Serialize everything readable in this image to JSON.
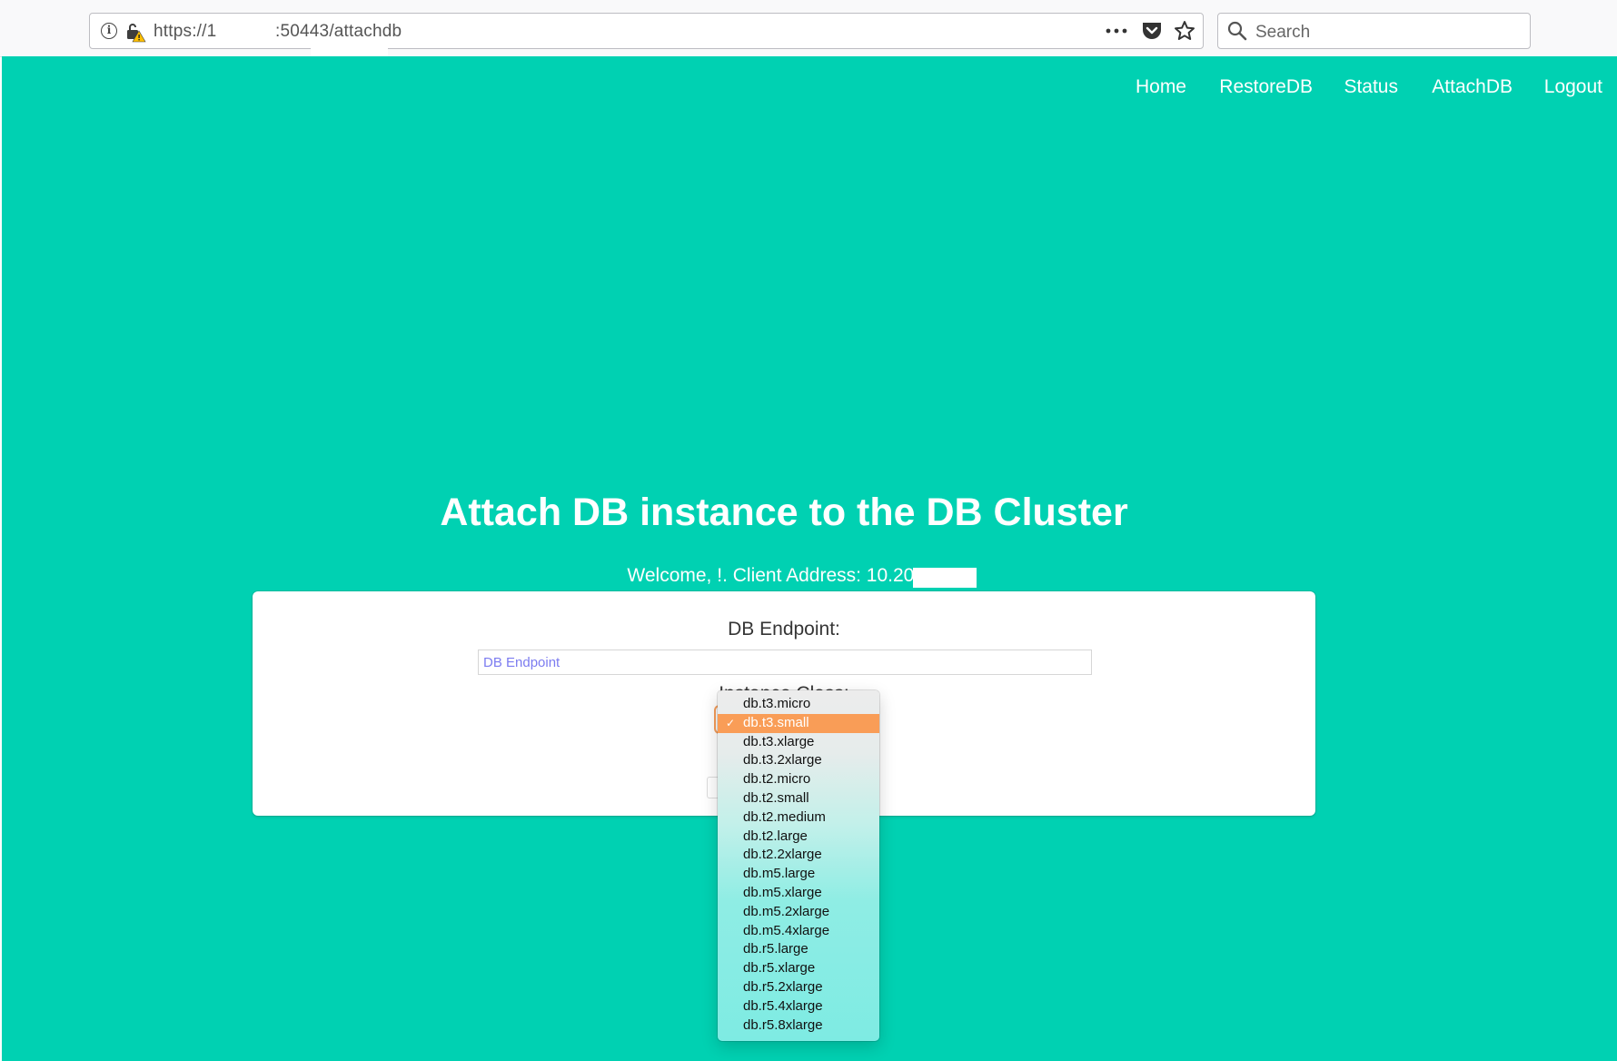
{
  "browser": {
    "url_prefix": "https://1",
    "url_suffix": ":50443/attachdb",
    "search_placeholder": "Search"
  },
  "nav": {
    "items": [
      "Home",
      "RestoreDB",
      "Status",
      "AttachDB",
      "Logout"
    ]
  },
  "page": {
    "title": "Attach DB instance to the DB Cluster",
    "welcome": "Welcome, !. Client Address: 10.200.2"
  },
  "form": {
    "endpoint_label": "DB Endpoint:",
    "endpoint_placeholder": "DB Endpoint",
    "instance_class_label": "Instance Class:",
    "selected_value": "db.t3.small"
  },
  "dropdown": {
    "options": [
      "db.t3.micro",
      "db.t3.small",
      "db.t3.xlarge",
      "db.t3.2xlarge",
      "db.t2.micro",
      "db.t2.small",
      "db.t2.medium",
      "db.t2.large",
      "db.t2.2xlarge",
      "db.m5.large",
      "db.m5.xlarge",
      "db.m5.2xlarge",
      "db.m5.4xlarge",
      "db.r5.large",
      "db.r5.xlarge",
      "db.r5.2xlarge",
      "db.r5.4xlarge",
      "db.r5.8xlarge"
    ],
    "selected_index": 1,
    "checkmark": "✓"
  },
  "colors": {
    "page_bg": "#00d1b2",
    "selection": "#f99d57",
    "placeholder_text": "#7c7cf0"
  }
}
